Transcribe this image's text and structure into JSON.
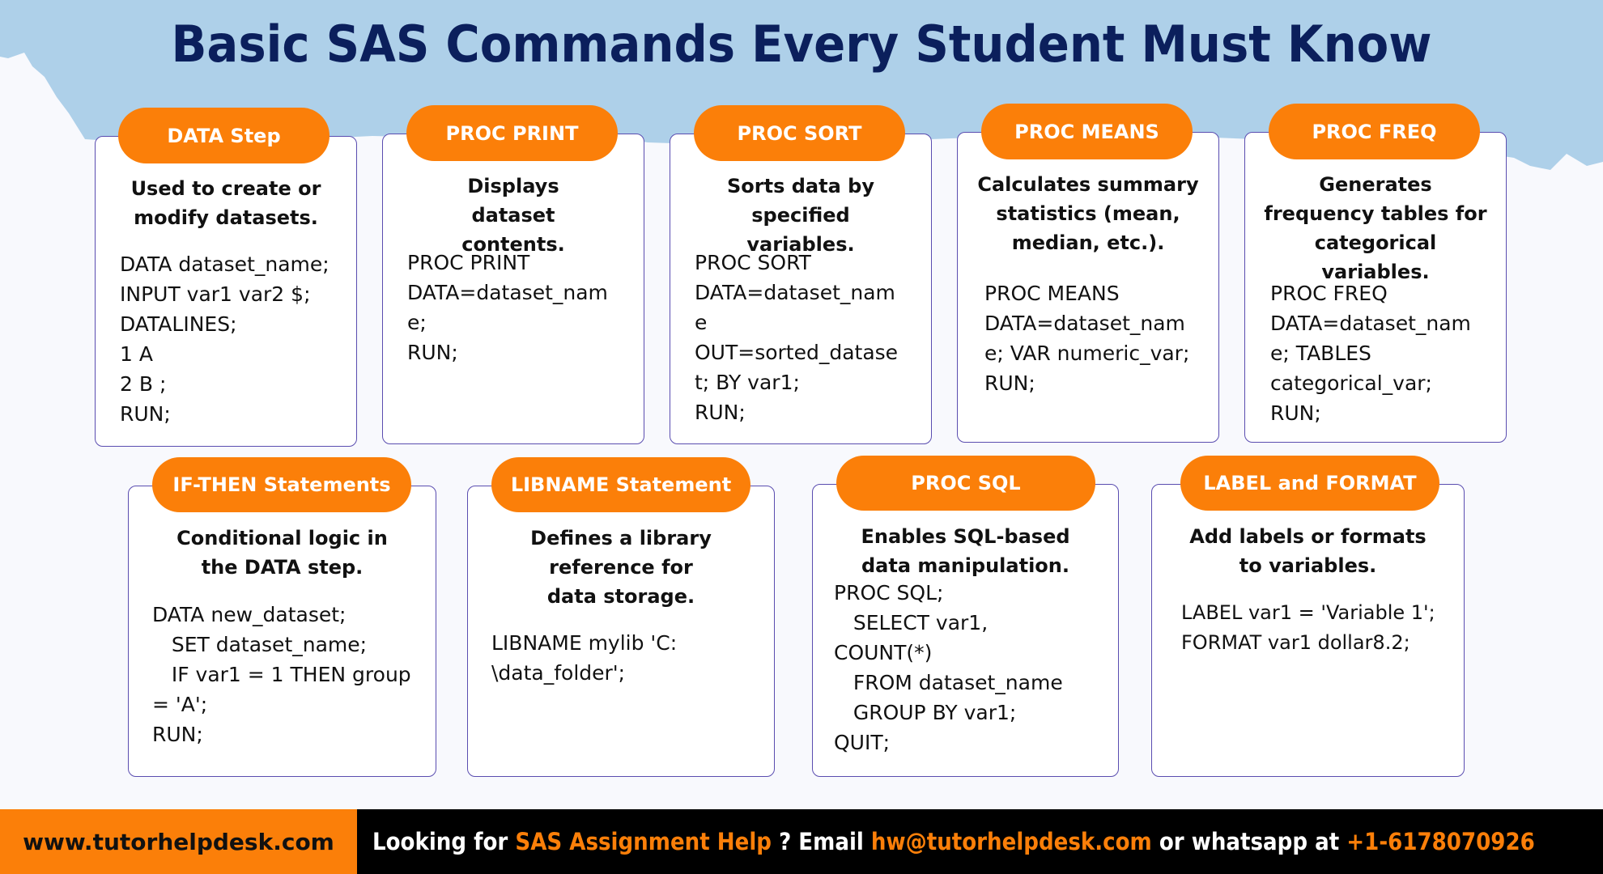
{
  "title": "Basic SAS Commands Every Student Must Know",
  "colors": {
    "accent": "#fb7f09",
    "title": "#0b1f5c",
    "banner": "#aed0e9",
    "card_border": "#5a4db0",
    "footer_bg": "#000000"
  },
  "cards": [
    {
      "title": "DATA Step",
      "description": "Used to create or modify datasets.",
      "code": "DATA dataset_name;\nINPUT var1 var2 $;\nDATALINES;\n1 A\n2 B ;\nRUN;"
    },
    {
      "title": "PROC PRINT",
      "description": "Displays dataset contents.",
      "code": "PROC PRINT\nDATA=dataset_nam\ne;\nRUN;"
    },
    {
      "title": "PROC SORT",
      "description": "Sorts data by specified variables.",
      "code": "PROC SORT\nDATA=dataset_nam\ne\nOUT=sorted_datase\nt; BY var1;\nRUN;"
    },
    {
      "title": "PROC MEANS",
      "description": "Calculates summary statistics (mean, median, etc.).",
      "code": "PROC MEANS\nDATA=dataset_nam\ne; VAR numeric_var;\nRUN;"
    },
    {
      "title": "PROC FREQ",
      "description": "Generates frequency tables for categorical variables.",
      "code": "PROC FREQ\nDATA=dataset_nam\ne; TABLES\ncategorical_var;\nRUN;"
    },
    {
      "title": "IF-THEN Statements",
      "description": "Conditional logic in the DATA step.",
      "code": "DATA new_dataset;\n   SET dataset_name;\n   IF var1 = 1 THEN group\n= 'A';\nRUN;"
    },
    {
      "title": "LIBNAME Statement",
      "description": "Defines a library reference for data storage.",
      "code": "LIBNAME mylib 'C:\n\\data_folder';"
    },
    {
      "title": "PROC SQL",
      "description": "Enables SQL-based data manipulation.",
      "code": "PROC SQL;\n   SELECT var1,\nCOUNT(*)\n   FROM dataset_name\n   GROUP BY var1;\nQUIT;"
    },
    {
      "title": "LABEL and FORMAT",
      "description": "Add labels or formats to variables.",
      "code": "LABEL var1 = 'Variable 1';\nFORMAT var1 dollar8.2;"
    }
  ],
  "footer": {
    "website": "www.tutorhelpdesk.com",
    "msg_part1": "Looking for ",
    "msg_highlight1": "SAS Assignment Help",
    "msg_part2": " ? Email ",
    "msg_email": "hw@tutorhelpdesk.com",
    "msg_part3": " or whatsapp at ",
    "msg_phone": "+1-6178070926"
  }
}
